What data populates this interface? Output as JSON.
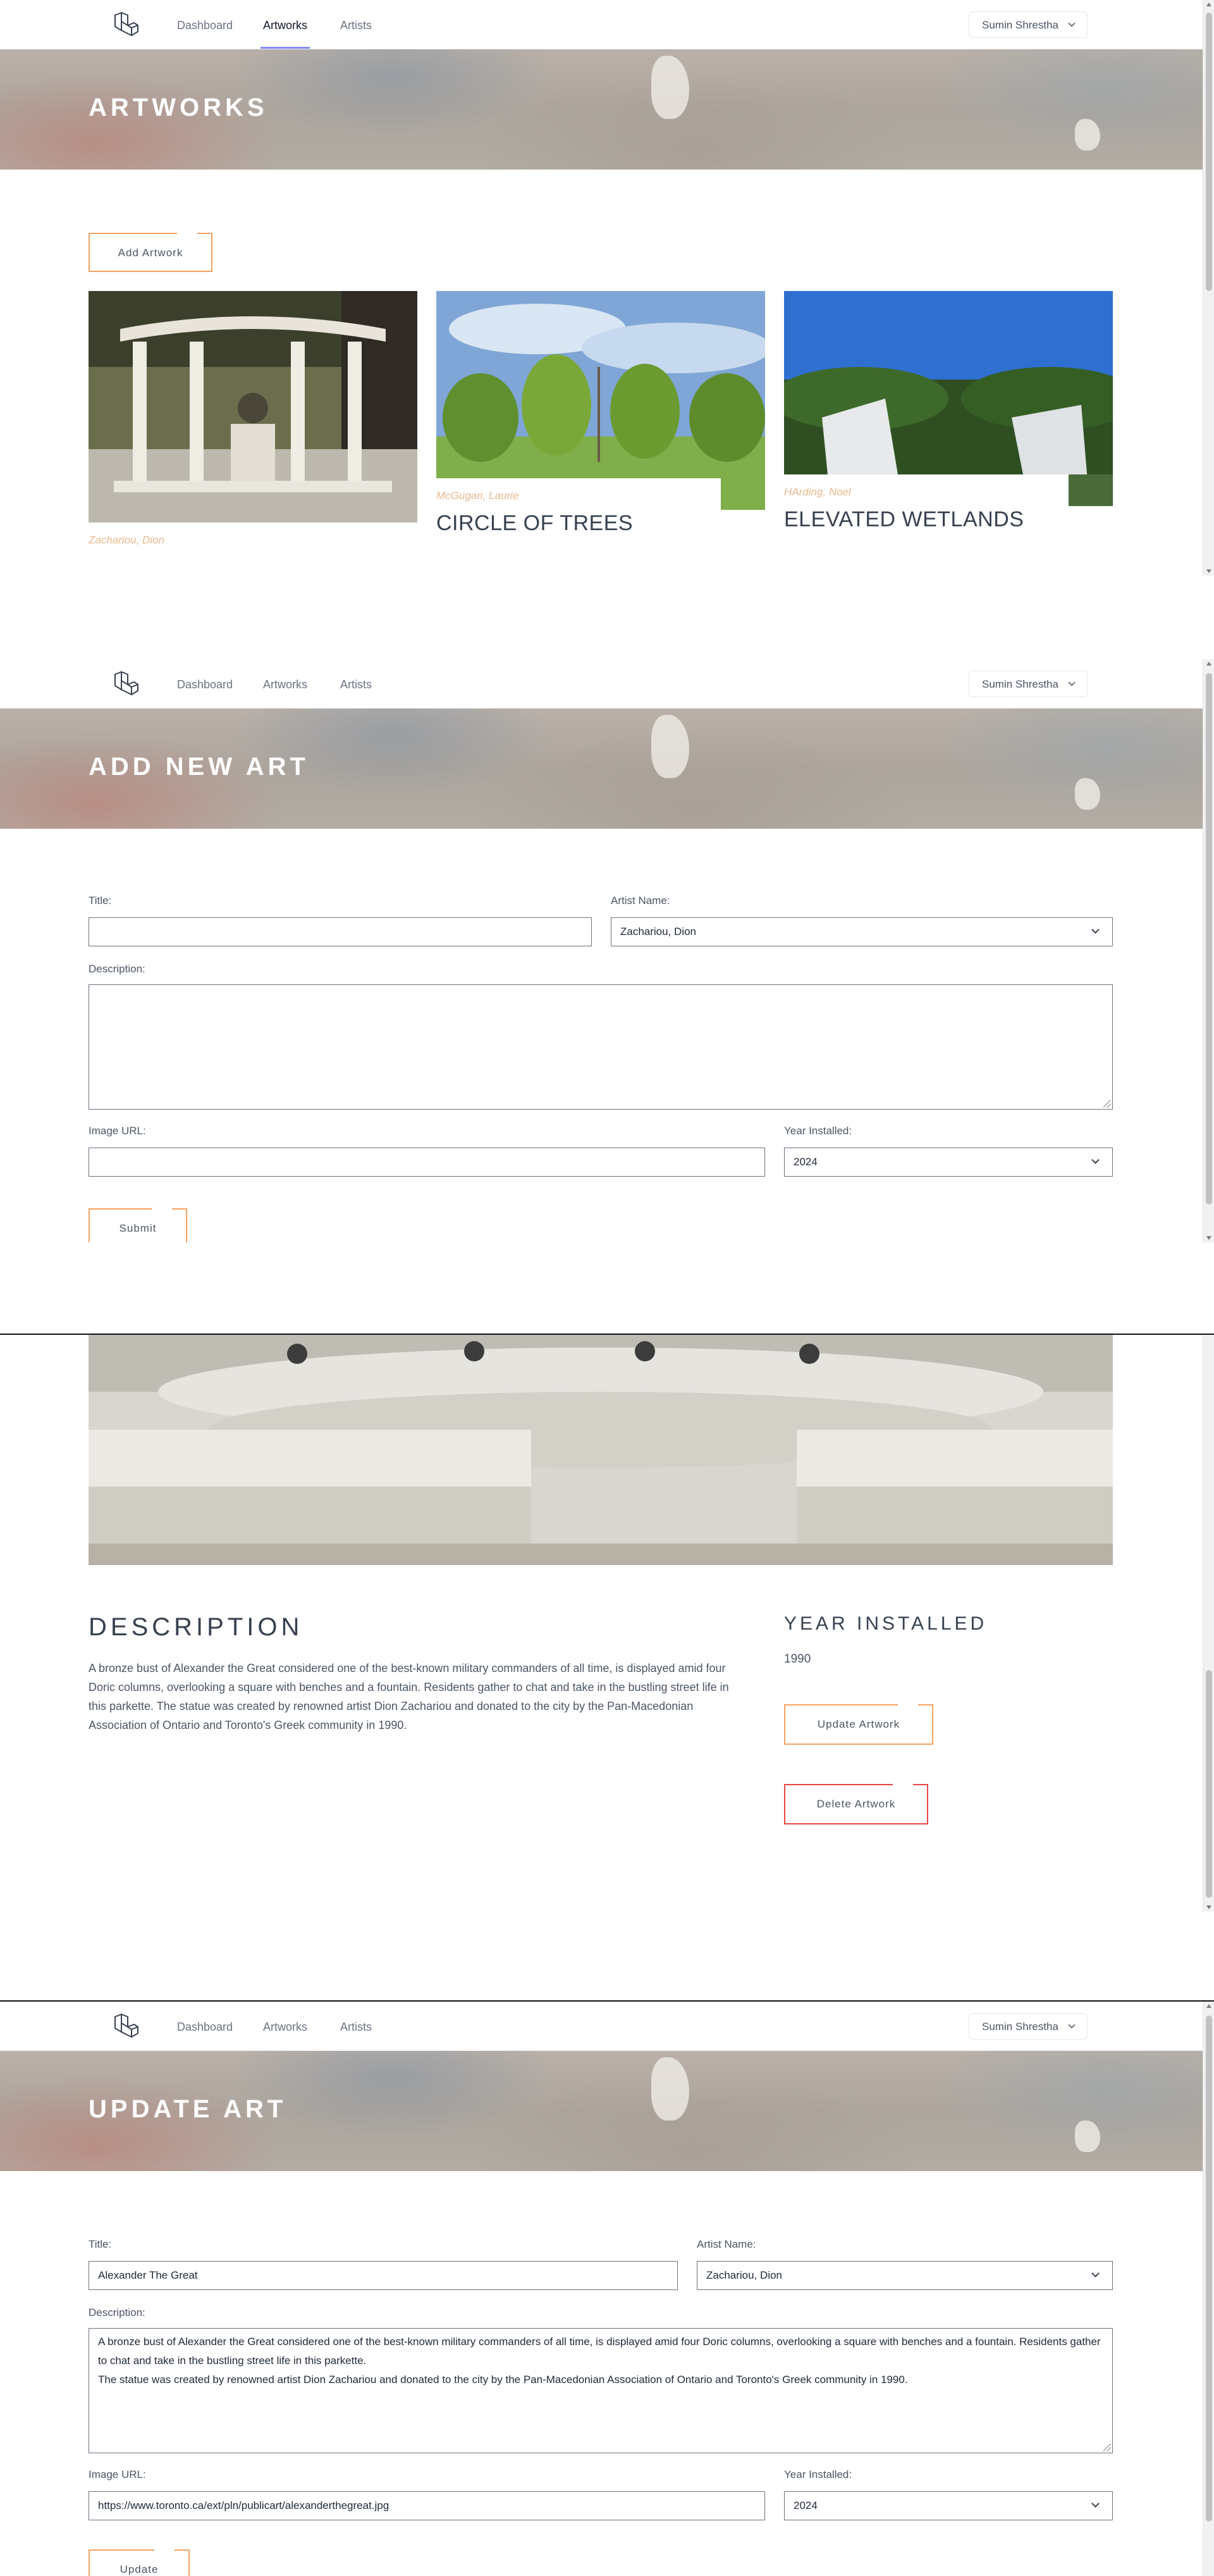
{
  "nav": {
    "links": [
      "Dashboard",
      "Artworks",
      "Artists"
    ],
    "user": "Sumin Shrestha"
  },
  "artworks_page": {
    "banner_title": "ARTWORKS",
    "add_button": "Add Artwork",
    "cards": [
      {
        "artist": "Zachariou, Dion",
        "title": ""
      },
      {
        "artist": "McGugan, Laurie",
        "title": "CIRCLE OF TREES"
      },
      {
        "artist": "HArding, Noel",
        "title": "ELEVATED WETLANDS"
      }
    ]
  },
  "add_page": {
    "banner_title": "ADD NEW ART",
    "title_label": "Title:",
    "title_value": "",
    "artist_label": "Artist Name:",
    "artist_value": "Zachariou, Dion",
    "description_label": "Description:",
    "description_value": "",
    "image_label": "Image URL:",
    "image_value": "",
    "year_label": "Year Installed:",
    "year_value": "2024",
    "submit": "Submit"
  },
  "detail_page": {
    "description_heading": "DESCRIPTION",
    "description_text": "A bronze bust of Alexander the Great considered one of the best-known military commanders of all time, is displayed amid four Doric columns, overlooking a square with benches and a fountain. Residents gather to chat and take in the bustling street life in this parkette. The statue was created by renowned artist Dion Zachariou and donated to the city by the Pan-Macedonian Association of Ontario and Toronto's Greek community in 1990.",
    "year_heading": "YEAR INSTALLED",
    "year_value": "1990",
    "update_button": "Update Artwork",
    "delete_button": "Delete Artwork"
  },
  "update_page": {
    "banner_title": "UPDATE ART",
    "title_label": "Title:",
    "title_value": "Alexander The Great",
    "artist_label": "Artist Name:",
    "artist_value": "Zachariou, Dion",
    "description_label": "Description:",
    "description_value": "A bronze bust of Alexander the Great considered one of the best-known military commanders of all time, is displayed amid four Doric columns, overlooking a square with benches and a fountain. Residents gather to chat and take in the bustling street life in this parkette.\nThe statue was created by renowned artist Dion Zachariou and donated to the city by the Pan-Macedonian Association of Ontario and Toronto's Greek community in 1990.",
    "image_label": "Image URL:",
    "image_value": "https://www.toronto.ca/ext/pln/publicart/alexanderthegreat.jpg",
    "year_label": "Year Installed:",
    "year_value": "2024",
    "update": "Update"
  },
  "colors": {
    "accent_orange": "#f4a261",
    "nav_active_underline": "#818cf8",
    "danger": "#ef4444",
    "artist_text": "#e9b98d"
  }
}
